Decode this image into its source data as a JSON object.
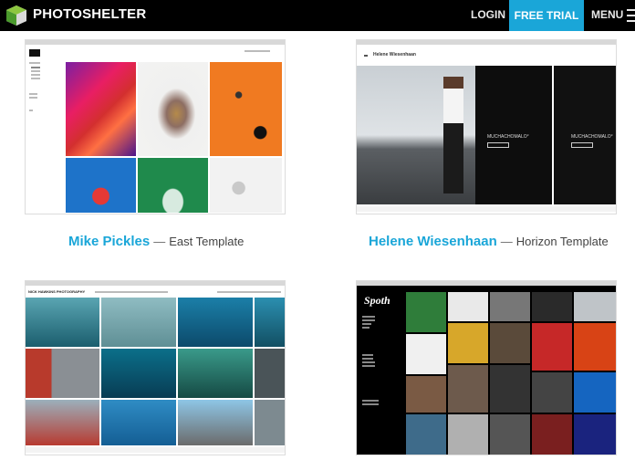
{
  "header": {
    "brand": "PHOTOSHELTER",
    "nav": {
      "login": "LOGIN",
      "free_trial": "FREE TRIAL",
      "menu": "MENU"
    },
    "colors": {
      "bar": "#000000",
      "accent": "#1aa6d8"
    }
  },
  "showcase": [
    {
      "photographer": "Mike Pickles",
      "dash": "—",
      "template": "East Template"
    },
    {
      "photographer": "Helene Wiesenhaan",
      "dash": "—",
      "template": "Horizon Template"
    }
  ],
  "previews": {
    "helene": {
      "site_title": "Helene Wiesenhaan",
      "banner": "MUCHACHOMALO°"
    },
    "nick": {
      "site_title": "NICK HAWKINS PHOTOGRAPHY"
    },
    "spoth": {
      "logo": "Spoth"
    }
  }
}
